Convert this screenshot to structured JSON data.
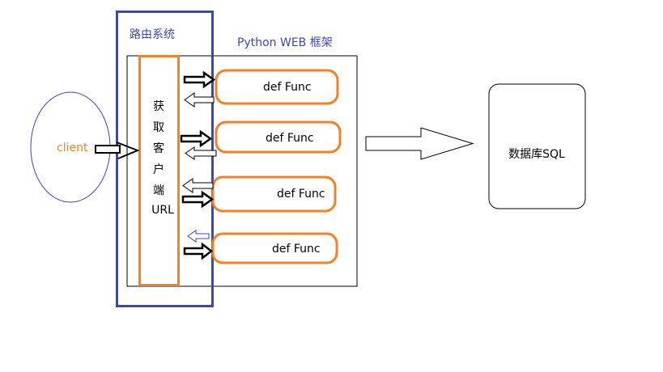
{
  "router": {
    "title": "路由系统",
    "url_label_chars": [
      "获",
      "取",
      "客",
      "户",
      "端"
    ],
    "url_label_tail": "URL"
  },
  "framework": {
    "title": "Python WEB 框架",
    "funcs": [
      "def Func",
      "def Func",
      "def Func",
      "def Func"
    ]
  },
  "client": {
    "label": "client"
  },
  "database": {
    "label": "数据库SQL"
  },
  "colors": {
    "router_border": "#3c46b4",
    "orange": "#f08228",
    "black": "#000000",
    "blue_text": "#3c46b4",
    "client_ellipse": "#3c46b4",
    "client_text": "#f08228"
  }
}
